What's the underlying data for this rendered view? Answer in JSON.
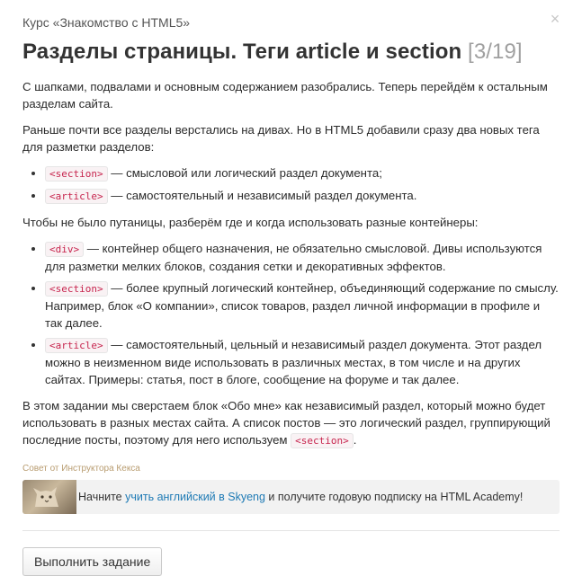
{
  "header": {
    "course": "Курс «Знакомство с HTML5»",
    "close_glyph": "×",
    "close_icon": "close-icon",
    "title": "Разделы страницы. Теги article и section",
    "counter": "[3/19]"
  },
  "content": {
    "p1": "С шапками, подвалами и основным содержанием разобрались. Теперь перейдём к остальным разделам сайта.",
    "p2": "Раньше почти все разделы верстались на дивах. Но в HTML5 добавили сразу два новых тега для разметки разделов:",
    "list1": [
      {
        "tag": "<section>",
        "text": " — смысловой или логический раздел документа;"
      },
      {
        "tag": "<article>",
        "text": " — самостоятельный и независимый раздел документа."
      }
    ],
    "p3": "Чтобы не было путаницы, разберём где и когда использовать разные контейнеры:",
    "list2": [
      {
        "tag": "<div>",
        "text": " — контейнер общего назначения, не обязательно смысловой. Дивы используются для разметки мелких блоков, создания сетки и декоративных эффектов."
      },
      {
        "tag": "<section>",
        "text": " — более крупный логический контейнер, объединяющий содержание по смыслу. Например, блок «О компании», список товаров, раздел личной информации в профиле и так далее."
      },
      {
        "tag": "<article>",
        "text": " — самостоятельный, цельный и независимый раздел документа. Этот раздел можно в неизменном виде использовать в различных местах, в том числе и на других сайтах. Примеры: статья, пост в блоге, сообщение на форуме и так далее."
      }
    ],
    "p4_text": "В этом задании мы сверстаем блок «Обо мне» как независимый раздел, который можно будет использовать в разных местах сайта. А список постов — это логический раздел, группирующий последние посты, поэтому для него используем ",
    "p4_tag": "<section>",
    "p4_end": "."
  },
  "advice": {
    "label": "Совет от Инструктора Кекса",
    "avatar_icon": "cat-avatar-icon",
    "text_before": "Начните ",
    "link": "учить английский в Skyeng",
    "text_after": " и получите годовую подписку на HTML Academy!"
  },
  "actions": {
    "submit": "Выполнить задание"
  },
  "colors": {
    "code_text": "#c7254e",
    "code_bg": "#f9f2f4",
    "link": "#1e7ab5",
    "advice_label": "#b89c70"
  }
}
